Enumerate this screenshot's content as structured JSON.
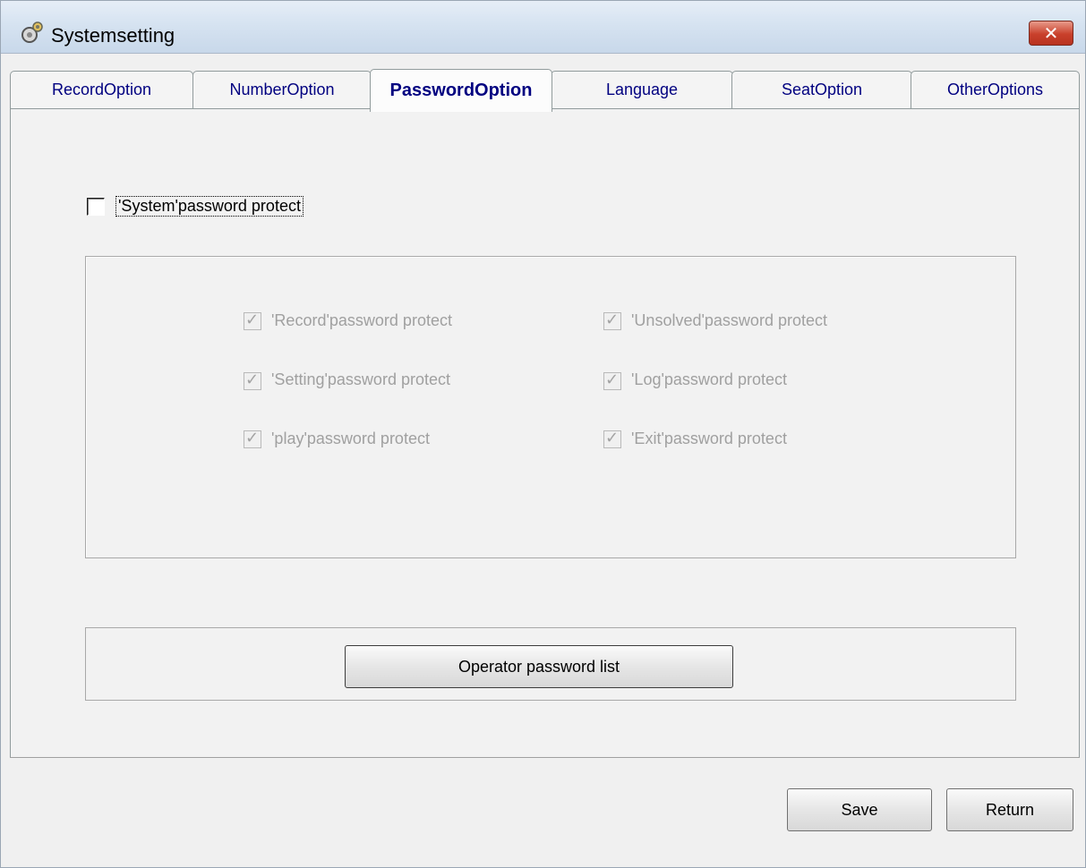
{
  "window": {
    "title": "Systemsetting",
    "close_glyph": "✕"
  },
  "tabs": [
    {
      "label": "RecordOption",
      "active": false
    },
    {
      "label": "NumberOption",
      "active": false
    },
    {
      "label": "PasswordOption",
      "active": true
    },
    {
      "label": "Language",
      "active": false
    },
    {
      "label": "SeatOption",
      "active": false
    },
    {
      "label": "OtherOptions",
      "active": false
    }
  ],
  "password_option": {
    "system_protect": {
      "label": "'System'password protect",
      "checked": false
    },
    "options": [
      {
        "label": "'Record'password protect",
        "checked": true,
        "enabled": false
      },
      {
        "label": "'Unsolved'password protect",
        "checked": true,
        "enabled": false
      },
      {
        "label": "'Setting'password protect",
        "checked": true,
        "enabled": false
      },
      {
        "label": "'Log'password protect",
        "checked": true,
        "enabled": false
      },
      {
        "label": "'play'password protect",
        "checked": true,
        "enabled": false
      },
      {
        "label": "'Exit'password protect",
        "checked": true,
        "enabled": false
      }
    ],
    "operator_button_label": "Operator password list"
  },
  "footer": {
    "save_label": "Save",
    "return_label": "Return"
  },
  "colors": {
    "tab_text": "#000080",
    "disabled_text": "#a0a0a0",
    "close_button": "#c9402b"
  }
}
